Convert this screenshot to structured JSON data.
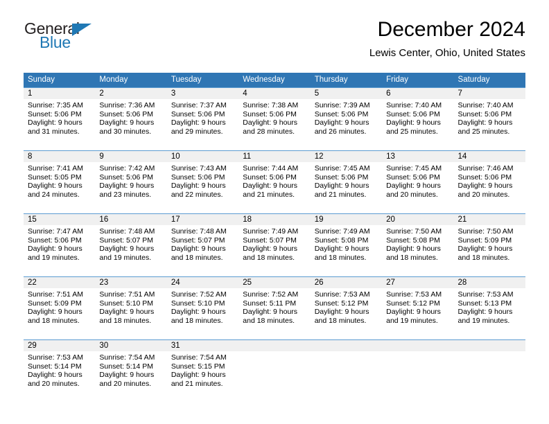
{
  "brand": {
    "line1": "General",
    "line2": "Blue",
    "triangle_color": "#1f78b4"
  },
  "header": {
    "title": "December 2024",
    "subtitle": "Lewis Center, Ohio, United States"
  },
  "theme": {
    "header_bg": "#2f76b4",
    "daynum_bg": "#f0f0f0",
    "row_border": "#5b9bd1"
  },
  "calendar": {
    "weekday_headers": [
      "Sunday",
      "Monday",
      "Tuesday",
      "Wednesday",
      "Thursday",
      "Friday",
      "Saturday"
    ],
    "weeks": [
      [
        {
          "day": "1",
          "sunrise": "Sunrise: 7:35 AM",
          "sunset": "Sunset: 5:06 PM",
          "daylight1": "Daylight: 9 hours",
          "daylight2": "and 31 minutes."
        },
        {
          "day": "2",
          "sunrise": "Sunrise: 7:36 AM",
          "sunset": "Sunset: 5:06 PM",
          "daylight1": "Daylight: 9 hours",
          "daylight2": "and 30 minutes."
        },
        {
          "day": "3",
          "sunrise": "Sunrise: 7:37 AM",
          "sunset": "Sunset: 5:06 PM",
          "daylight1": "Daylight: 9 hours",
          "daylight2": "and 29 minutes."
        },
        {
          "day": "4",
          "sunrise": "Sunrise: 7:38 AM",
          "sunset": "Sunset: 5:06 PM",
          "daylight1": "Daylight: 9 hours",
          "daylight2": "and 28 minutes."
        },
        {
          "day": "5",
          "sunrise": "Sunrise: 7:39 AM",
          "sunset": "Sunset: 5:06 PM",
          "daylight1": "Daylight: 9 hours",
          "daylight2": "and 26 minutes."
        },
        {
          "day": "6",
          "sunrise": "Sunrise: 7:40 AM",
          "sunset": "Sunset: 5:06 PM",
          "daylight1": "Daylight: 9 hours",
          "daylight2": "and 25 minutes."
        },
        {
          "day": "7",
          "sunrise": "Sunrise: 7:40 AM",
          "sunset": "Sunset: 5:06 PM",
          "daylight1": "Daylight: 9 hours",
          "daylight2": "and 25 minutes."
        }
      ],
      [
        {
          "day": "8",
          "sunrise": "Sunrise: 7:41 AM",
          "sunset": "Sunset: 5:05 PM",
          "daylight1": "Daylight: 9 hours",
          "daylight2": "and 24 minutes."
        },
        {
          "day": "9",
          "sunrise": "Sunrise: 7:42 AM",
          "sunset": "Sunset: 5:06 PM",
          "daylight1": "Daylight: 9 hours",
          "daylight2": "and 23 minutes."
        },
        {
          "day": "10",
          "sunrise": "Sunrise: 7:43 AM",
          "sunset": "Sunset: 5:06 PM",
          "daylight1": "Daylight: 9 hours",
          "daylight2": "and 22 minutes."
        },
        {
          "day": "11",
          "sunrise": "Sunrise: 7:44 AM",
          "sunset": "Sunset: 5:06 PM",
          "daylight1": "Daylight: 9 hours",
          "daylight2": "and 21 minutes."
        },
        {
          "day": "12",
          "sunrise": "Sunrise: 7:45 AM",
          "sunset": "Sunset: 5:06 PM",
          "daylight1": "Daylight: 9 hours",
          "daylight2": "and 21 minutes."
        },
        {
          "day": "13",
          "sunrise": "Sunrise: 7:45 AM",
          "sunset": "Sunset: 5:06 PM",
          "daylight1": "Daylight: 9 hours",
          "daylight2": "and 20 minutes."
        },
        {
          "day": "14",
          "sunrise": "Sunrise: 7:46 AM",
          "sunset": "Sunset: 5:06 PM",
          "daylight1": "Daylight: 9 hours",
          "daylight2": "and 20 minutes."
        }
      ],
      [
        {
          "day": "15",
          "sunrise": "Sunrise: 7:47 AM",
          "sunset": "Sunset: 5:06 PM",
          "daylight1": "Daylight: 9 hours",
          "daylight2": "and 19 minutes."
        },
        {
          "day": "16",
          "sunrise": "Sunrise: 7:48 AM",
          "sunset": "Sunset: 5:07 PM",
          "daylight1": "Daylight: 9 hours",
          "daylight2": "and 19 minutes."
        },
        {
          "day": "17",
          "sunrise": "Sunrise: 7:48 AM",
          "sunset": "Sunset: 5:07 PM",
          "daylight1": "Daylight: 9 hours",
          "daylight2": "and 18 minutes."
        },
        {
          "day": "18",
          "sunrise": "Sunrise: 7:49 AM",
          "sunset": "Sunset: 5:07 PM",
          "daylight1": "Daylight: 9 hours",
          "daylight2": "and 18 minutes."
        },
        {
          "day": "19",
          "sunrise": "Sunrise: 7:49 AM",
          "sunset": "Sunset: 5:08 PM",
          "daylight1": "Daylight: 9 hours",
          "daylight2": "and 18 minutes."
        },
        {
          "day": "20",
          "sunrise": "Sunrise: 7:50 AM",
          "sunset": "Sunset: 5:08 PM",
          "daylight1": "Daylight: 9 hours",
          "daylight2": "and 18 minutes."
        },
        {
          "day": "21",
          "sunrise": "Sunrise: 7:50 AM",
          "sunset": "Sunset: 5:09 PM",
          "daylight1": "Daylight: 9 hours",
          "daylight2": "and 18 minutes."
        }
      ],
      [
        {
          "day": "22",
          "sunrise": "Sunrise: 7:51 AM",
          "sunset": "Sunset: 5:09 PM",
          "daylight1": "Daylight: 9 hours",
          "daylight2": "and 18 minutes."
        },
        {
          "day": "23",
          "sunrise": "Sunrise: 7:51 AM",
          "sunset": "Sunset: 5:10 PM",
          "daylight1": "Daylight: 9 hours",
          "daylight2": "and 18 minutes."
        },
        {
          "day": "24",
          "sunrise": "Sunrise: 7:52 AM",
          "sunset": "Sunset: 5:10 PM",
          "daylight1": "Daylight: 9 hours",
          "daylight2": "and 18 minutes."
        },
        {
          "day": "25",
          "sunrise": "Sunrise: 7:52 AM",
          "sunset": "Sunset: 5:11 PM",
          "daylight1": "Daylight: 9 hours",
          "daylight2": "and 18 minutes."
        },
        {
          "day": "26",
          "sunrise": "Sunrise: 7:53 AM",
          "sunset": "Sunset: 5:12 PM",
          "daylight1": "Daylight: 9 hours",
          "daylight2": "and 18 minutes."
        },
        {
          "day": "27",
          "sunrise": "Sunrise: 7:53 AM",
          "sunset": "Sunset: 5:12 PM",
          "daylight1": "Daylight: 9 hours",
          "daylight2": "and 19 minutes."
        },
        {
          "day": "28",
          "sunrise": "Sunrise: 7:53 AM",
          "sunset": "Sunset: 5:13 PM",
          "daylight1": "Daylight: 9 hours",
          "daylight2": "and 19 minutes."
        }
      ],
      [
        {
          "day": "29",
          "sunrise": "Sunrise: 7:53 AM",
          "sunset": "Sunset: 5:14 PM",
          "daylight1": "Daylight: 9 hours",
          "daylight2": "and 20 minutes."
        },
        {
          "day": "30",
          "sunrise": "Sunrise: 7:54 AM",
          "sunset": "Sunset: 5:14 PM",
          "daylight1": "Daylight: 9 hours",
          "daylight2": "and 20 minutes."
        },
        {
          "day": "31",
          "sunrise": "Sunrise: 7:54 AM",
          "sunset": "Sunset: 5:15 PM",
          "daylight1": "Daylight: 9 hours",
          "daylight2": "and 21 minutes."
        },
        {
          "day": "",
          "sunrise": "",
          "sunset": "",
          "daylight1": "",
          "daylight2": ""
        },
        {
          "day": "",
          "sunrise": "",
          "sunset": "",
          "daylight1": "",
          "daylight2": ""
        },
        {
          "day": "",
          "sunrise": "",
          "sunset": "",
          "daylight1": "",
          "daylight2": ""
        },
        {
          "day": "",
          "sunrise": "",
          "sunset": "",
          "daylight1": "",
          "daylight2": ""
        }
      ]
    ]
  }
}
